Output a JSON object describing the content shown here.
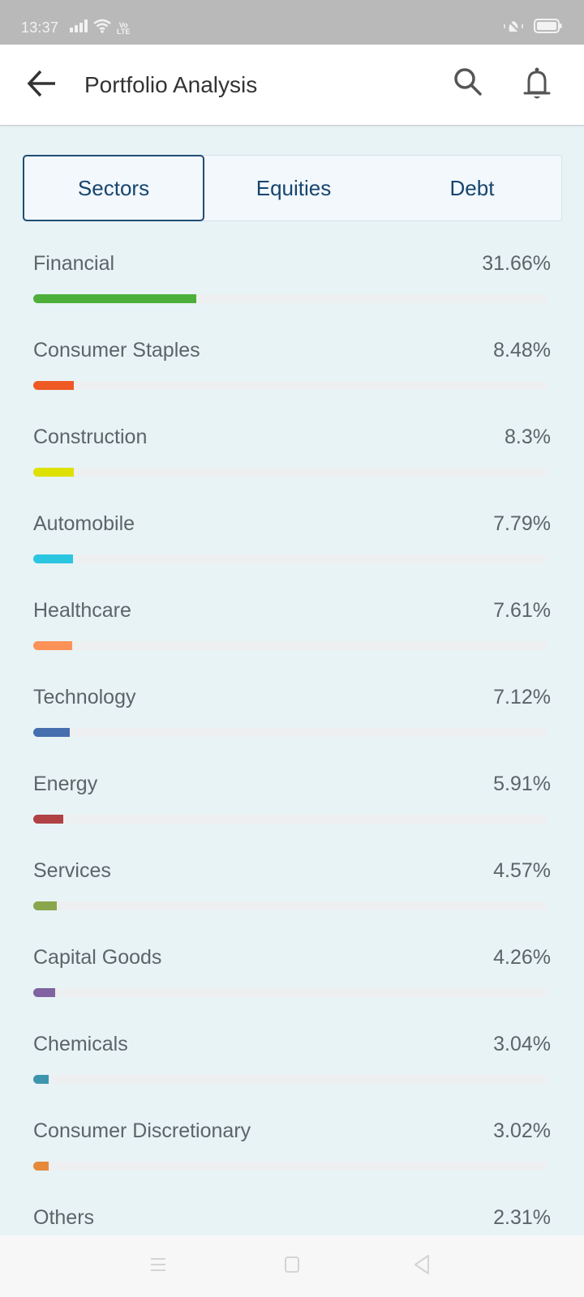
{
  "status_bar": {
    "time": "13:37",
    "network_label": "Vo LTE",
    "icons": [
      "signal-icon",
      "wifi-icon",
      "volte-icon",
      "vibrate-off-icon",
      "battery-icon"
    ]
  },
  "app_bar": {
    "title": "Portfolio Analysis",
    "back_icon": "arrow-left-icon",
    "search_icon": "search-icon",
    "notifications_icon": "bell-icon"
  },
  "tabs": [
    {
      "label": "Sectors",
      "active": true
    },
    {
      "label": "Equities",
      "active": false
    },
    {
      "label": "Debt",
      "active": false
    }
  ],
  "sectors": [
    {
      "name": "Financial",
      "value_label": "31.66%",
      "percent": 31.66,
      "color": "#4caf3a"
    },
    {
      "name": "Consumer Staples",
      "value_label": "8.48%",
      "percent": 8.48,
      "color": "#ef5a24"
    },
    {
      "name": "Construction",
      "value_label": "8.3%",
      "percent": 8.3,
      "color": "#dde000"
    },
    {
      "name": "Automobile",
      "value_label": "7.79%",
      "percent": 7.79,
      "color": "#2ac6e0"
    },
    {
      "name": "Healthcare",
      "value_label": "7.61%",
      "percent": 7.61,
      "color": "#fc9257"
    },
    {
      "name": "Technology",
      "value_label": "7.12%",
      "percent": 7.12,
      "color": "#456fae"
    },
    {
      "name": "Energy",
      "value_label": "5.91%",
      "percent": 5.91,
      "color": "#b04245"
    },
    {
      "name": "Services",
      "value_label": "4.57%",
      "percent": 4.57,
      "color": "#89a64d"
    },
    {
      "name": "Capital Goods",
      "value_label": "4.26%",
      "percent": 4.26,
      "color": "#7f64a1"
    },
    {
      "name": "Chemicals",
      "value_label": "3.04%",
      "percent": 3.04,
      "color": "#3d95ad"
    },
    {
      "name": "Consumer Discretionary",
      "value_label": "3.02%",
      "percent": 3.02,
      "color": "#e48a3a"
    },
    {
      "name": "Others",
      "value_label": "2.31%",
      "percent": 2.31,
      "color": "#999999"
    }
  ],
  "nav_bar": {
    "icons": [
      "menu-icon",
      "home-icon",
      "back-triangle-icon"
    ]
  }
}
